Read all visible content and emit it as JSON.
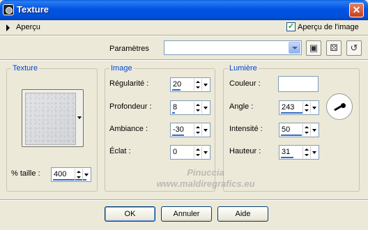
{
  "window": {
    "title": "Texture",
    "close_symbol": "✕"
  },
  "preview": {
    "label": "Aperçu",
    "checkbox_label": "Aperçu de l'image",
    "checked": true
  },
  "settings": {
    "label": "Paramètres",
    "value": ""
  },
  "texture_group": {
    "title": "Texture",
    "size_label": "% taille :",
    "size_value": "400"
  },
  "image_group": {
    "title": "Image",
    "regularity_label": "Régularité :",
    "regularity_value": "20",
    "depth_label": "Profondeur :",
    "depth_value": "8",
    "ambiance_label": "Ambiance :",
    "ambiance_value": "-30",
    "eclat_label": "Éclat :",
    "eclat_value": "0"
  },
  "light_group": {
    "title": "Lumière",
    "color_label": "Couleur :",
    "color_value": "#ffffff",
    "angle_label": "Angle :",
    "angle_value": "243",
    "intensity_label": "Intensité :",
    "intensity_value": "50",
    "height_label": "Hauteur :",
    "height_value": "31"
  },
  "watermark": {
    "line1": "Pinuccia",
    "line2": "www.maldiregrafics.eu"
  },
  "buttons": {
    "ok": "OK",
    "cancel": "Annuler",
    "help": "Aide"
  },
  "colors": {
    "titlebar": "#0054e3",
    "group_title": "#0046d5",
    "spin_bar": "#316ac5"
  }
}
